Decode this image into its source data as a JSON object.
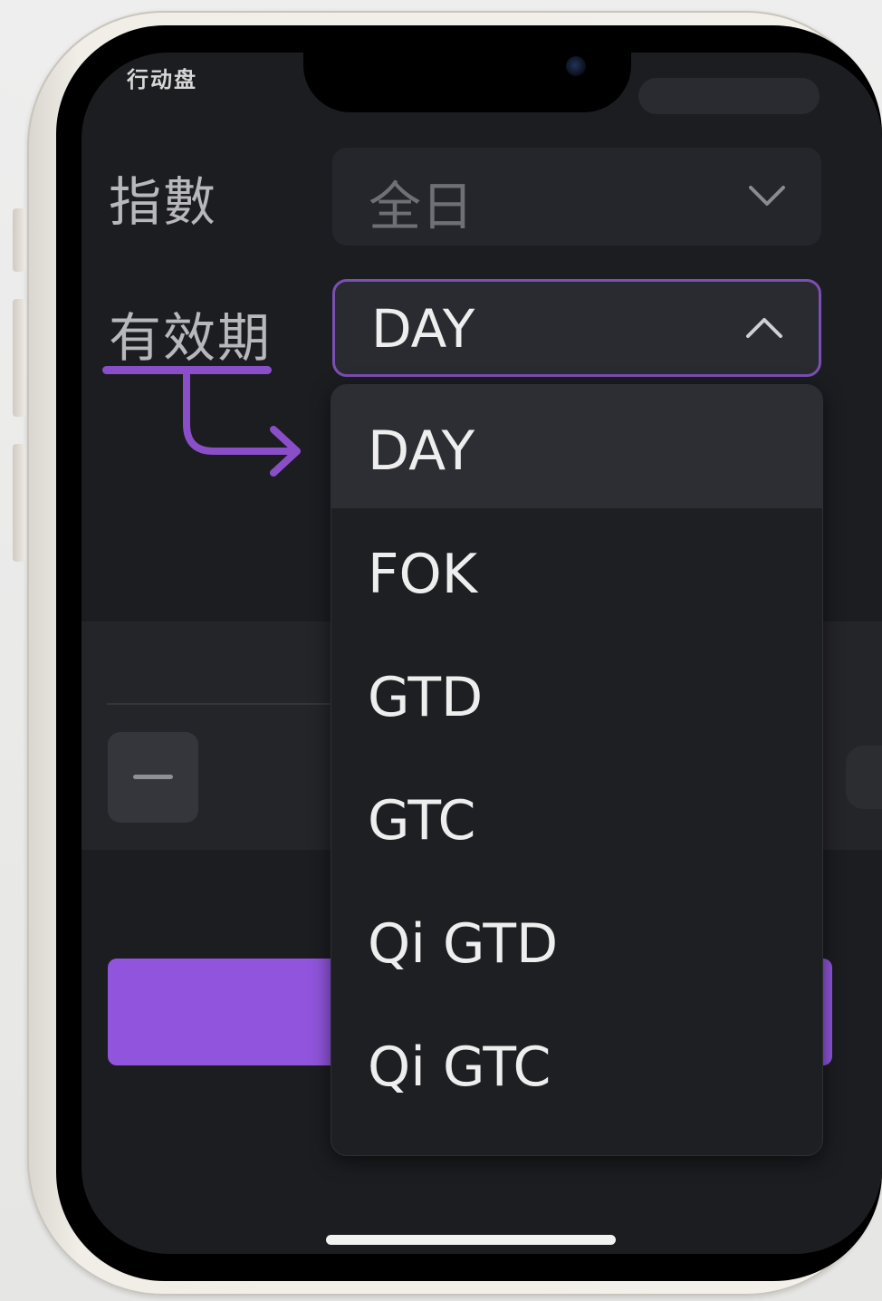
{
  "top_cut_text": "行动盘",
  "index_field": {
    "label": "指數",
    "value": "全日"
  },
  "validity_field": {
    "label": "有效期",
    "value": "DAY"
  },
  "dropdown": {
    "options": [
      "DAY",
      "FOK",
      "GTD",
      "GTC",
      "Qi GTD",
      "Qi GTC"
    ],
    "selected": "DAY"
  },
  "colors": {
    "accent": "#9155dd",
    "select_border": "#7b4fb4",
    "background": "#1c1d21"
  },
  "icons": {
    "index_chevron": "chevron-down-icon",
    "validity_chevron": "chevron-up-icon",
    "annotation": "arrow-annotation-icon"
  }
}
